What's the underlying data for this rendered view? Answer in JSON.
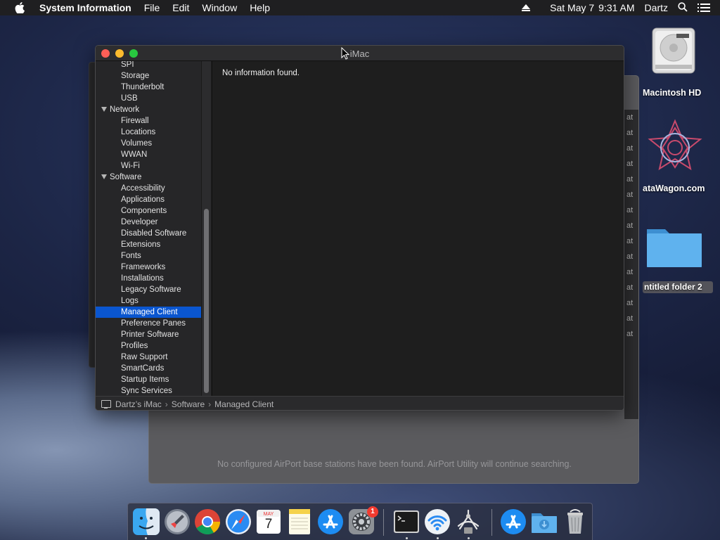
{
  "menubar": {
    "app_name": "System Information",
    "menus": [
      "File",
      "Edit",
      "Window",
      "Help"
    ],
    "date": "Sat May 7",
    "time": "9:31 AM",
    "user": "Dartz"
  },
  "window": {
    "title": "iMac",
    "sidebar": [
      {
        "label": "SPI",
        "level": "child"
      },
      {
        "label": "Storage",
        "level": "child"
      },
      {
        "label": "Thunderbolt",
        "level": "child"
      },
      {
        "label": "USB",
        "level": "child"
      },
      {
        "label": "Network",
        "level": "group"
      },
      {
        "label": "Firewall",
        "level": "child"
      },
      {
        "label": "Locations",
        "level": "child"
      },
      {
        "label": "Volumes",
        "level": "child"
      },
      {
        "label": "WWAN",
        "level": "child"
      },
      {
        "label": "Wi-Fi",
        "level": "child"
      },
      {
        "label": "Software",
        "level": "group"
      },
      {
        "label": "Accessibility",
        "level": "child"
      },
      {
        "label": "Applications",
        "level": "child"
      },
      {
        "label": "Components",
        "level": "child"
      },
      {
        "label": "Developer",
        "level": "child"
      },
      {
        "label": "Disabled Software",
        "level": "child"
      },
      {
        "label": "Extensions",
        "level": "child"
      },
      {
        "label": "Fonts",
        "level": "child"
      },
      {
        "label": "Frameworks",
        "level": "child"
      },
      {
        "label": "Installations",
        "level": "child"
      },
      {
        "label": "Legacy Software",
        "level": "child"
      },
      {
        "label": "Logs",
        "level": "child"
      },
      {
        "label": "Managed Client",
        "level": "child",
        "selected": true
      },
      {
        "label": "Preference Panes",
        "level": "child"
      },
      {
        "label": "Printer Software",
        "level": "child"
      },
      {
        "label": "Profiles",
        "level": "child"
      },
      {
        "label": "Raw Support",
        "level": "child"
      },
      {
        "label": "SmartCards",
        "level": "child"
      },
      {
        "label": "Startup Items",
        "level": "child"
      },
      {
        "label": "Sync Services",
        "level": "child"
      }
    ],
    "content_text": "No information found.",
    "path": {
      "computer": "Dartz’s iMac",
      "section": "Software",
      "item": "Managed Client",
      "separator": "›"
    }
  },
  "background_window": {
    "message": "No configured AirPort base stations have been found. AirPort Utility will continue searching.",
    "strip_fragment": "at"
  },
  "desktop": {
    "icons": [
      {
        "label": "Macintosh HD",
        "icon": "hard-drive-icon"
      },
      {
        "label": "ataWagon.com",
        "icon": "datawagon-logo-icon"
      },
      {
        "label": "ntitled folder 2",
        "icon": "folder-icon"
      }
    ]
  },
  "dock": {
    "apps": [
      "finder-icon",
      "launchpad-icon",
      "chrome-icon",
      "safari-icon",
      "calendar-icon",
      "notes-icon",
      "app-store-icon",
      "system-preferences-icon",
      "terminal-icon",
      "airport-utility-icon",
      "directory-utility-icon",
      "app-store-icon",
      "downloads-folder-icon",
      "trash-icon"
    ],
    "calendar": {
      "month": "MAY",
      "day": "7"
    },
    "system_preferences_badge": "1",
    "colors": {
      "accent": "#0a56d0",
      "badge": "#f23b30"
    }
  }
}
